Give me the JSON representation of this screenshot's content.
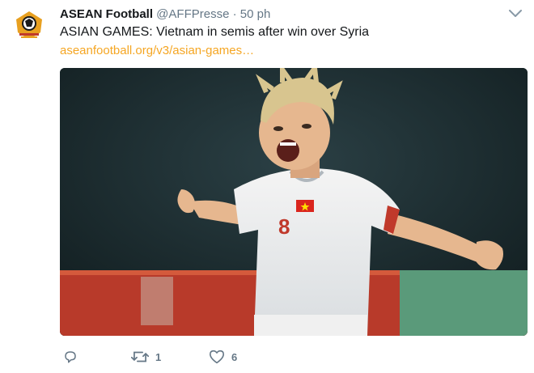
{
  "tweet": {
    "author_name": "ASEAN Football",
    "handle": "@AFFPresse",
    "separator": "·",
    "time": "50 ph",
    "text": "ASIAN GAMES: Vietnam in semis after win over Syria",
    "link_text": "aseanfootball.org/v3/asian-games…",
    "media_description_icon": "photo",
    "jersey_number": "8"
  },
  "actions": {
    "reply_count": "",
    "retweet_count": "1",
    "like_count": "6"
  },
  "colors": {
    "link": "#f5a623",
    "muted": "#657786",
    "text": "#14171a"
  }
}
